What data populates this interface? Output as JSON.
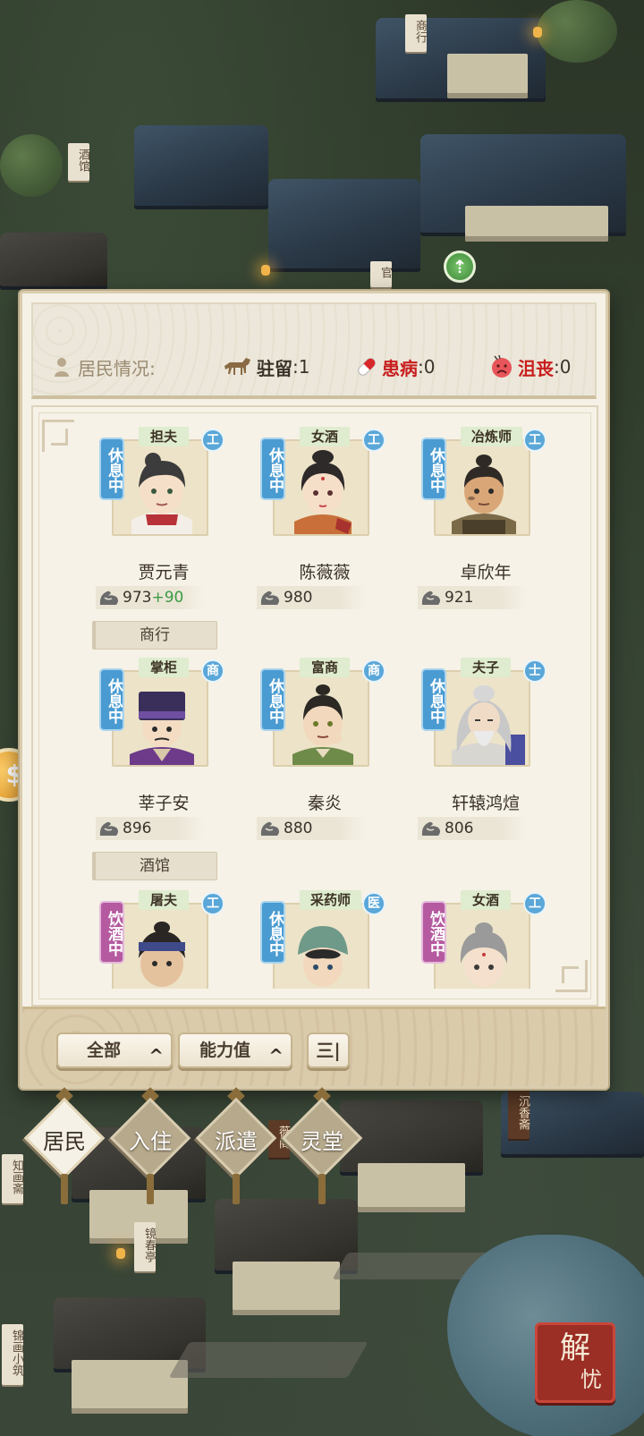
{
  "status": {
    "resident_label": "居民情况:",
    "station_label": "驻留",
    "station_value": ":1",
    "sick_label": "患病",
    "sick_value": ":0",
    "sad_label": "沮丧",
    "sad_value": ":0"
  },
  "residents": [
    {
      "job": "担夫",
      "state": "休息中",
      "state_type": "rest",
      "class": "工",
      "name": "贾元青",
      "power": "973",
      "bonus": "+90",
      "building": "商行"
    },
    {
      "job": "女酒",
      "state": "休息中",
      "state_type": "rest",
      "class": "工",
      "name": "陈薇薇",
      "power": "980",
      "bonus": "",
      "building": ""
    },
    {
      "job": "冶炼师",
      "state": "休息中",
      "state_type": "rest",
      "class": "工",
      "name": "卓欣年",
      "power": "921",
      "bonus": "",
      "building": ""
    },
    {
      "job": "掌柜",
      "state": "休息中",
      "state_type": "rest",
      "class": "商",
      "name": "莘子安",
      "power": "896",
      "bonus": "",
      "building": "酒馆"
    },
    {
      "job": "富商",
      "state": "休息中",
      "state_type": "rest",
      "class": "商",
      "name": "秦炎",
      "power": "880",
      "bonus": "",
      "building": ""
    },
    {
      "job": "夫子",
      "state": "休息中",
      "state_type": "rest",
      "class": "士",
      "name": "轩辕鸿煊",
      "power": "806",
      "bonus": "",
      "building": ""
    },
    {
      "job": "屠夫",
      "state": "饮酒中",
      "state_type": "drink",
      "class": "工",
      "name": "",
      "power": "",
      "bonus": "",
      "building": ""
    },
    {
      "job": "采药师",
      "state": "休息中",
      "state_type": "rest",
      "class": "医",
      "name": "",
      "power": "",
      "bonus": "",
      "building": ""
    },
    {
      "job": "女酒",
      "state": "饮酒中",
      "state_type": "drink",
      "class": "工",
      "name": "",
      "power": "",
      "bonus": "",
      "building": ""
    }
  ],
  "sort": {
    "filter_label": "全部",
    "sort_label": "能力值",
    "order_icon": "三|"
  },
  "tabs": [
    {
      "label": "居民",
      "active": true
    },
    {
      "label": "入住",
      "active": false
    },
    {
      "label": "派遣",
      "active": false
    },
    {
      "label": "灵堂",
      "active": false
    }
  ],
  "map_signs": [
    "商行",
    "酒馆",
    "官",
    "知画斋",
    "镜春亭",
    "锦画小筑",
    "薇阁",
    "沉香斋"
  ],
  "seal_text": {
    "big": "解",
    "small": "忧"
  },
  "icons": {
    "resident": "person-icon",
    "station": "horse-icon",
    "sick": "pill-icon",
    "sad": "sad-face-icon",
    "power": "flexed-arm-icon"
  },
  "colors": {
    "rest_state": "#4a9bd1",
    "drink_state": "#b55aa0",
    "class_badge": "#5aa7d8",
    "alert_red": "#c81e1e",
    "bonus_green": "#3b9b47"
  }
}
